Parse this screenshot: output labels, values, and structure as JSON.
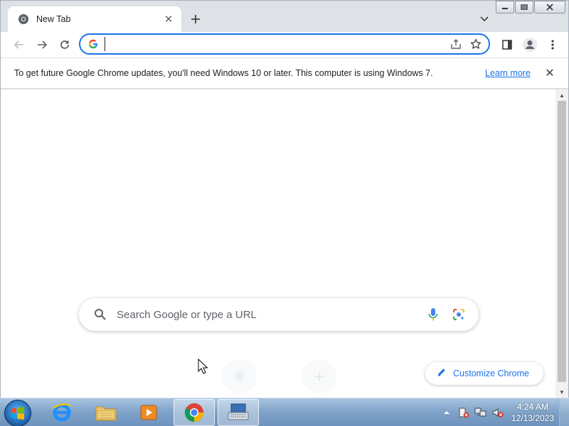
{
  "tab": {
    "title": "New Tab",
    "favicon": "chrome-icon",
    "close_icon": "close-icon"
  },
  "window_controls": {
    "minimize": "minimize-icon",
    "maximize": "restore-icon",
    "close": "close-icon"
  },
  "toolbar": {
    "back_icon": "arrow-left-icon",
    "forward_icon": "arrow-right-icon",
    "reload_icon": "reload-icon",
    "omnibox_value": "",
    "omnibox_icon": "google-g-icon",
    "share_icon": "share-icon",
    "bookmark_icon": "star-icon",
    "side_panel_icon": "side-panel-icon",
    "profile_icon": "avatar-icon",
    "menu_icon": "kebab-menu-icon"
  },
  "infobar": {
    "message": "To get future Google Chrome updates, you'll need Windows 10 or later. This computer is using Windows 7.",
    "link": "Learn more"
  },
  "ntp": {
    "search_placeholder": "Search Google or type a URL",
    "customize_label": "Customize Chrome"
  },
  "taskbar": {
    "items": [
      "internet-explorer-icon",
      "file-explorer-icon",
      "media-player-icon",
      "chrome-icon",
      "on-screen-keyboard-icon"
    ],
    "active_item": "chrome-icon",
    "clock_time": "4:24 AM",
    "clock_date": "12/13/2023"
  },
  "colors": {
    "accent": "#1a73e8",
    "tabstrip": "#dee1e6",
    "taskbar": "#7fa2c8"
  }
}
